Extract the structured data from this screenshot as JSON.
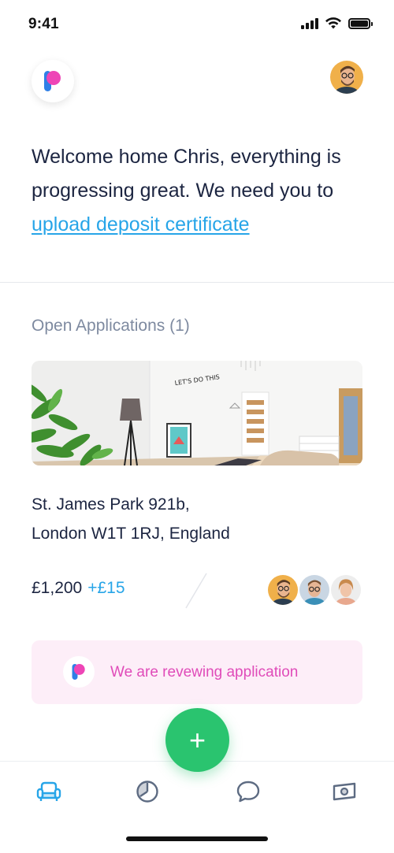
{
  "status_bar": {
    "time": "9:41"
  },
  "welcome": {
    "text_before": "Welcome home Chris, everything is progressing great. We need you to ",
    "link": "upload deposit certificate"
  },
  "section": {
    "title": "Open Applications (1)"
  },
  "listing": {
    "address_line1": "St. James Park 921b,",
    "address_line2": "London W1T 1RJ, England",
    "price": "£1,200",
    "price_extra": "+£15",
    "wall_art_text": "LET'S DO THIS"
  },
  "status_card": {
    "text": "We are revewing application"
  },
  "fab": {
    "label": "+"
  },
  "colors": {
    "accent_blue": "#27a5e8",
    "brand_pink": "#e04bb9",
    "fab_green": "#2ac46f",
    "text_dark": "#1c2541",
    "text_muted": "#7e8aa0",
    "card_bg": "#fdeef8"
  },
  "tabs": [
    {
      "icon": "armchair-icon",
      "active": true
    },
    {
      "icon": "clock-icon",
      "active": false
    },
    {
      "icon": "chat-bubble-icon",
      "active": false
    },
    {
      "icon": "money-icon",
      "active": false
    }
  ]
}
